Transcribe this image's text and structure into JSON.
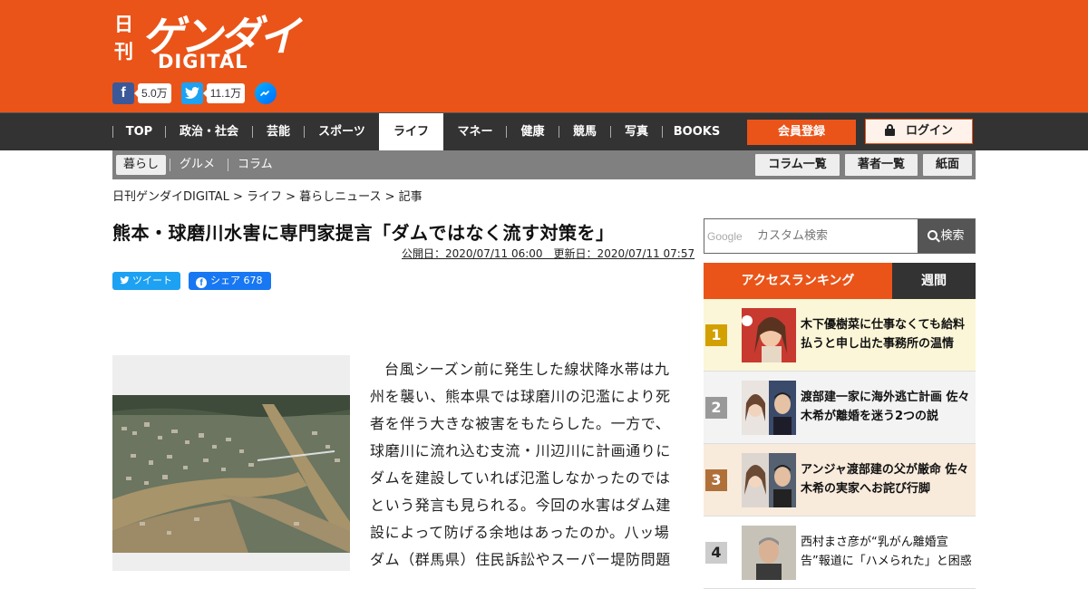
{
  "header": {
    "logo_nikkan": "日刊",
    "logo_gendai": "ゲンダイ",
    "logo_digital": "DIGITAL",
    "facebook_count": "5.0万",
    "twitter_count": "11.1万"
  },
  "nav": {
    "items": [
      "TOP",
      "政治・社会",
      "芸能",
      "スポーツ",
      "ライフ",
      "マネー",
      "健康",
      "競馬",
      "写真",
      "BOOKS"
    ],
    "active": "ライフ",
    "register": "会員登録",
    "login": "ログイン"
  },
  "subnav": {
    "items": [
      "暮らし",
      "グルメ",
      "コラム"
    ],
    "buttons": [
      "コラム一覧",
      "著者一覧",
      "紙面"
    ]
  },
  "breadcrumb": "日刊ゲンダイDIGITAL > ライフ > 暮らしニュース > 記事",
  "article": {
    "title": "熊本・球磨川水害に専門家提言「ダムではなく流す対策を」",
    "dates": "公開日：2020/07/11 06:00　更新日：2020/07/11 07:57",
    "share_tweet": "ツイート",
    "share_fb": "シェア 678",
    "body": "台風シーズン前に発生した線状降水帯は九州を襲い、熊本県では球磨川の氾濫により死者を伴う大きな被害をもたらした。一方で、球磨川に流れ込む支流・川辺川に計画通りにダムを建設していれば氾濫しなかったのではという発言も見られる。今回の水害はダム建設によって防げる余地はあったのか。八ッ場ダム（群馬県）住民訴訟やスーパー堤防問題"
  },
  "search": {
    "google": "Google",
    "placeholder": "カスタム検索",
    "button": "検索"
  },
  "ranking": {
    "tab_access": "アクセスランキング",
    "tab_weekly": "週間",
    "items": [
      {
        "rank": "1",
        "text": "木下優樹菜に仕事なくても給料払うと申し出た事務所の温情"
      },
      {
        "rank": "2",
        "text": "渡部建一家に海外逃亡計画 佐々木希が離婚を迷う2つの説"
      },
      {
        "rank": "3",
        "text": "アンジャ渡部建の父が厳命 佐々木希の実家へお詫び行脚"
      },
      {
        "rank": "4",
        "text": "西村まさ彦が“乳がん離婚宣告”報道に「ハメられた」と困惑"
      }
    ]
  },
  "colors": {
    "brand": "#ea5419",
    "nav_bg": "#333333",
    "rank1": "#d2a000",
    "rank2": "#999999",
    "rank3": "#b0703a",
    "rank4": "#cccccc"
  }
}
